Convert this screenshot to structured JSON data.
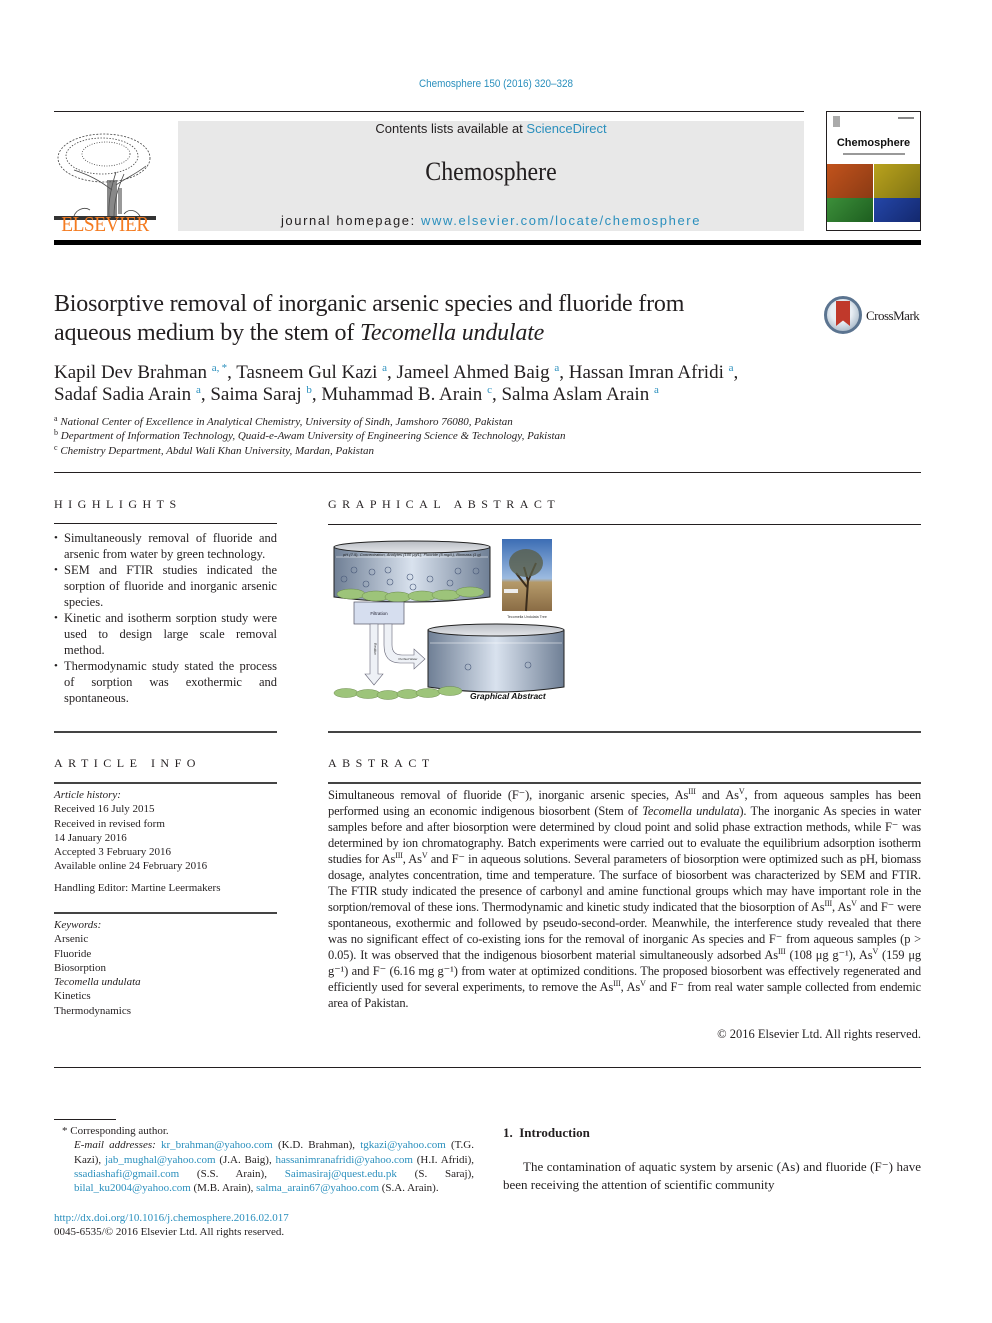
{
  "header": {
    "citation": "Chemosphere 150 (2016) 320–328",
    "contents_prefix": "Contents lists available at ",
    "contents_link": "ScienceDirect",
    "journal_title": "Chemosphere",
    "homepage_prefix": "journal homepage: ",
    "homepage_link": "www.elsevier.com/locate/chemosphere",
    "publisher_logo_text": "ELSEVIER",
    "cover_title": "Chemosphere",
    "brand_color": "#f47b20",
    "link_color": "#2a8fbd"
  },
  "article": {
    "title_line1": "Biosorptive removal of inorganic arsenic species and fluoride from",
    "title_line2_plain": "aqueous medium by the stem of ",
    "title_line2_italic": "Tecomella undulate",
    "crossmark_label": "CrossMark",
    "authors": [
      {
        "name": "Kapil Dev Brahman",
        "sup": "a, *"
      },
      {
        "name": "Tasneem Gul Kazi",
        "sup": "a"
      },
      {
        "name": "Jameel Ahmed Baig",
        "sup": "a"
      },
      {
        "name": "Hassan Imran Afridi",
        "sup": "a"
      },
      {
        "name": "Sadaf Sadia Arain",
        "sup": "a"
      },
      {
        "name": "Saima Saraj",
        "sup": "b"
      },
      {
        "name": "Muhammad B. Arain",
        "sup": "c"
      },
      {
        "name": "Salma Aslam Arain",
        "sup": "a"
      }
    ],
    "affiliations": [
      {
        "key": "a",
        "text": "National Center of Excellence in Analytical Chemistry, University of Sindh, Jamshoro 76080, Pakistan"
      },
      {
        "key": "b",
        "text": "Department of Information Technology, Quaid-e-Awam University of Engineering Science & Technology, Pakistan"
      },
      {
        "key": "c",
        "text": "Chemistry Department, Abdul Wali Khan University, Mardan, Pakistan"
      }
    ]
  },
  "highlights": {
    "heading": "HIGHLIGHTS",
    "items": [
      "Simultaneously removal of fluoride and arsenic from water by green technology.",
      "SEM and FTIR studies indicated the sorption of fluoride and inorganic arsenic species.",
      "Kinetic and isotherm sorption study were used to design large scale removal method.",
      "Thermodynamic study stated the process of sorption was exothermic and spontaneous."
    ]
  },
  "graphical_abstract": {
    "heading": "GRAPHICAL ABSTRACT",
    "tank_label": "pH (7.5), Concentration, Analytes (100 μg/L), Fluoride (5 mg/L), Biomass (1 g)",
    "filtration_label": "Filtration",
    "purified_label": "Purified Water",
    "residue_label": "Residue",
    "tree_caption": "Tecomella Undulata Tree",
    "caption": "Graphical Abstract"
  },
  "article_info": {
    "heading": "ARTICLE INFO",
    "history_label": "Article history:",
    "history": [
      "Received 16 July 2015",
      "Received in revised form",
      "14 January 2016",
      "Accepted 3 February 2016",
      "Available online 24 February 2016"
    ],
    "handling_editor": "Handling Editor: Martine Leermakers",
    "keywords_label": "Keywords:",
    "keywords": [
      "Arsenic",
      "Fluoride",
      "Biosorption",
      "Tecomella undulata",
      "Kinetics",
      "Thermodynamics"
    ]
  },
  "abstract": {
    "heading": "ABSTRACT",
    "p1": "Simultaneous removal of fluoride (F⁻), inorganic arsenic species, As",
    "p2": " and As",
    "p3": ", from aqueous samples has been performed using an economic indigenous biosorbent (Stem of ",
    "p3_italic": "Tecomella undulata",
    "p4": "). The inorganic As species in water samples before and after biosorption were determined by cloud point and solid phase extraction methods, while F⁻ was determined by ion chromatography. Batch experiments were carried out to evaluate the equilibrium adsorption isotherm studies for As",
    "p5": ", As",
    "p6": " and F⁻ in aqueous solutions. Several parameters of biosorption were optimized such as pH, biomass dosage, analytes concentration, time and temperature. The surface of biosorbent was characterized by SEM and FTIR. The FTIR study indicated the presence of carbonyl and amine functional groups which may have important role in the sorption/removal of these ions. Thermodynamic and kinetic study indicated that the biosorption of As",
    "p7": ", As",
    "p8": " and F⁻ were spontaneous, exothermic and followed by pseudo-second-order. Meanwhile, the interference study revealed that there was no significant effect of co-existing ions for the removal of inorganic As species and F⁻ from aqueous samples (p > 0.05). It was observed that the indigenous biosorbent material simultaneously adsorbed As",
    "p9": " (108 μg g⁻¹), As",
    "p10": " (159 μg g⁻¹) and F⁻ (6.16 mg g⁻¹) from water at optimized conditions. The proposed biosorbent was effectively regenerated and efficiently used for several experiments, to remove the As",
    "p11": ", As",
    "p12": " and F⁻ from real water sample collected from endemic area of Pakistan.",
    "sup_III": "III",
    "sup_V": "V",
    "copyright": "© 2016 Elsevier Ltd. All rights reserved."
  },
  "footnotes": {
    "corresponding": "* Corresponding author.",
    "email_label": "E-mail addresses: ",
    "emails": [
      {
        "email": "kr_brahman@yahoo.com",
        "who": " (K.D. Brahman), "
      },
      {
        "email": "tgkazi@yahoo.com",
        "who": " (T.G. Kazi), "
      },
      {
        "email": "jab_mughal@yahoo.com",
        "who": " (J.A. Baig), "
      },
      {
        "email": "hassanimranafridi@yahoo.com",
        "who": " (H.I. Afridi), "
      },
      {
        "email": "ssadiashafi@gmail.com",
        "who": " (S.S. Arain), "
      },
      {
        "email": "Saimasiraj@quest.edu.pk",
        "who": " (S. Saraj), "
      },
      {
        "email": "bilal_ku2004@yahoo.com",
        "who": " (M.B. Arain), "
      },
      {
        "email": "salma_arain67@yahoo.com",
        "who": " (S.A. Arain)."
      }
    ],
    "doi": "http://dx.doi.org/10.1016/j.chemosphere.2016.02.017",
    "issn": "0045-6535/© 2016 Elsevier Ltd. All rights reserved."
  },
  "introduction": {
    "heading": "1.  Introduction",
    "text": "The contamination of aquatic system by arsenic (As) and fluoride (F⁻) have been receiving the attention of scientific community"
  }
}
